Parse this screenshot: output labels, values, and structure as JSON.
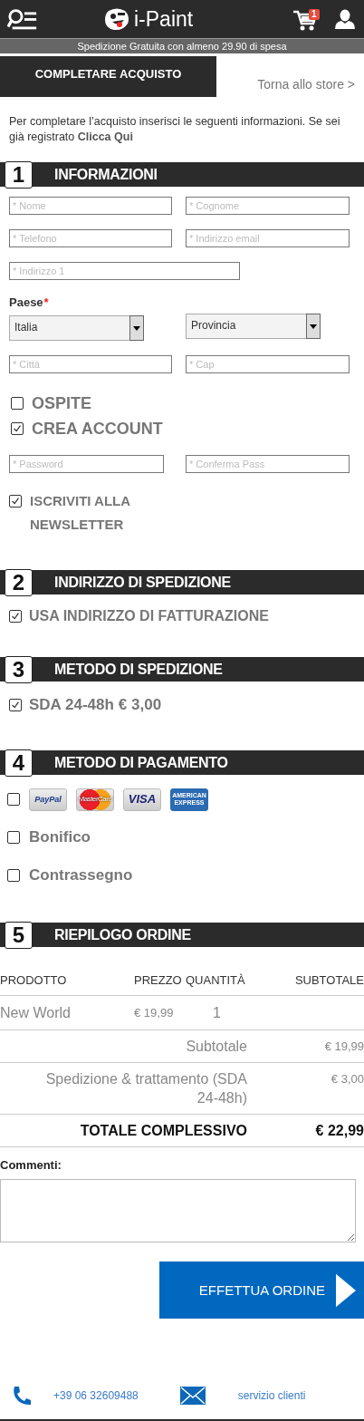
{
  "header": {
    "logo_text": "i-Paint",
    "cart_count": "1"
  },
  "promo": "Spedizione Gratuita con almeno 29.90 di spesa",
  "tabs": [
    {
      "label": "COMPLETARE ACQUISTO",
      "selected": true
    },
    {
      "label": "Torna allo store >",
      "selected": false
    }
  ],
  "intro": {
    "text": "Per completare l’acquisto inserisci le seguenti informazioni. Se sei già registrato",
    "link": "Clicca Qui"
  },
  "sections": [
    {
      "number": "1",
      "title": "INFORMAZIONI"
    },
    {
      "number": "2",
      "title": "INDIRIZZO DI SPEDIZIONE"
    },
    {
      "number": "3",
      "title": "METODO DI SPEDIZIONE"
    },
    {
      "number": "4",
      "title": "METODO DI PAGAMENTO"
    },
    {
      "number": "5",
      "title": "RIEPILOGO ORDINE"
    }
  ],
  "informazioni": {
    "fields": [
      {
        "placeholder": "* Nome"
      },
      {
        "placeholder": "* Cognome"
      },
      {
        "placeholder": "* Telefono"
      },
      {
        "placeholder": "* Indirizzo email"
      },
      {
        "placeholder": "* Indirizzo 1"
      }
    ],
    "country_label": "Paese",
    "required_mark": "*",
    "selects": [
      {
        "value": "Italia"
      },
      {
        "value": "Provincia"
      }
    ],
    "city_fields": [
      {
        "placeholder": "* Città"
      },
      {
        "placeholder": "* Cap"
      }
    ],
    "account_options": [
      {
        "label": "OSPITE",
        "checked": false
      },
      {
        "label": "CREA ACCOUNT",
        "checked": true
      }
    ],
    "password_fields": [
      {
        "placeholder": "* Password"
      },
      {
        "placeholder": "* Conferma Pass"
      }
    ],
    "newsletter": {
      "label": "ISCRIVITI ALLA NEWSLETTER",
      "checked": true
    }
  },
  "indirizzo_spedizione": {
    "label": "USA INDIRIZZO DI FATTURAZIONE",
    "checked": true
  },
  "metodo_spedizione": {
    "label": "SDA 24-48h",
    "price": "€ 3,00",
    "checked": true
  },
  "pagamento": [
    {
      "kind": "cards",
      "checked": false,
      "cards": [
        "PayPal",
        "MasterCard",
        "VISA",
        "AMERICAN EXPRESS"
      ]
    },
    {
      "kind": "text",
      "label": "Bonifico",
      "checked": false
    },
    {
      "kind": "text",
      "label": "Contrassegno",
      "checked": false
    }
  ],
  "riepilogo": {
    "columns": [
      "PRODOTTO",
      "PREZZO",
      "QUANTITÀ",
      "SUBTOTALE"
    ],
    "rows": [
      {
        "product": "New World",
        "price": "€ 19,99",
        "quantity": "1"
      }
    ],
    "summary": [
      {
        "kind": "normal",
        "label": "Subtotale",
        "value": "€ 19,99"
      },
      {
        "kind": "normal",
        "label": "Spedizione & trattamento (SDA 24-48h)",
        "value": "€ 3,00"
      },
      {
        "kind": "total",
        "label": "TOTALE COMPLESSIVO",
        "value": "€ 22,99"
      }
    ]
  },
  "comments_label": "Commenti:",
  "submit": "EFFETTUA ORDINE",
  "footer": {
    "phone": "+39 06 32609488",
    "service": "servizio clienti"
  }
}
